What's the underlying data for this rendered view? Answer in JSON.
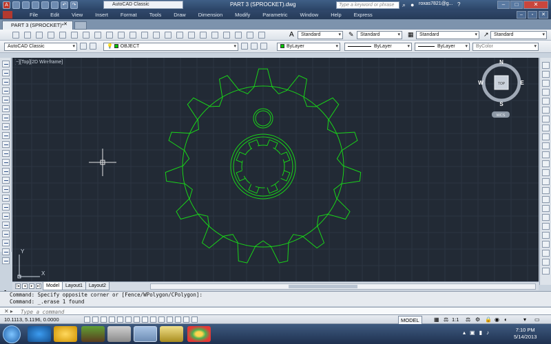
{
  "window": {
    "workspace_combo": "AutoCAD Classic",
    "title": "PART 3 (SPROCKET).dwg",
    "search_placeholder": "Type a keyword or phrase",
    "user": "roxas7821@g..."
  },
  "menu": {
    "items": [
      "File",
      "Edit",
      "View",
      "Insert",
      "Format",
      "Tools",
      "Draw",
      "Dimension",
      "Modify",
      "Parametric",
      "Window",
      "Help",
      "Express"
    ]
  },
  "file_tab": {
    "label": "PART 3 (SPROCKET)*"
  },
  "styles_toolbar": {
    "text_style": "Standard",
    "dim_style": "Standard",
    "table_style": "Standard",
    "mleader_style": "Standard"
  },
  "properties_toolbar": {
    "workspace": "AutoCAD Classic",
    "layer": "OBJECT",
    "color": "ByLayer",
    "linetype": "ByLayer",
    "lineweight": "ByLayer",
    "plotstyle": "ByColor"
  },
  "viewport": {
    "label": "[−][Top][2D Wireframe]",
    "viewcube": {
      "n": "N",
      "s": "S",
      "e": "E",
      "w": "W",
      "face": "TOP",
      "wcs": "WCS"
    },
    "ucs": {
      "x": "X",
      "y": "Y"
    }
  },
  "layout_tabs": [
    "Model",
    "Layout1",
    "Layout2"
  ],
  "command": {
    "history": [
      "Command: Specify opposite corner or [Fence/WPolygon/CPolygon]:",
      "Command: _.erase 1 found"
    ],
    "placeholder": "Type a command"
  },
  "status": {
    "coordinates": "10.1113, 5.1196, 0.0000",
    "model": "MODEL",
    "scale": "1:1"
  },
  "taskbar": {
    "time": "7:10 PM",
    "date": "5/14/2013"
  },
  "colors": {
    "geometry": "#19d419",
    "canvas": "#222a35"
  }
}
